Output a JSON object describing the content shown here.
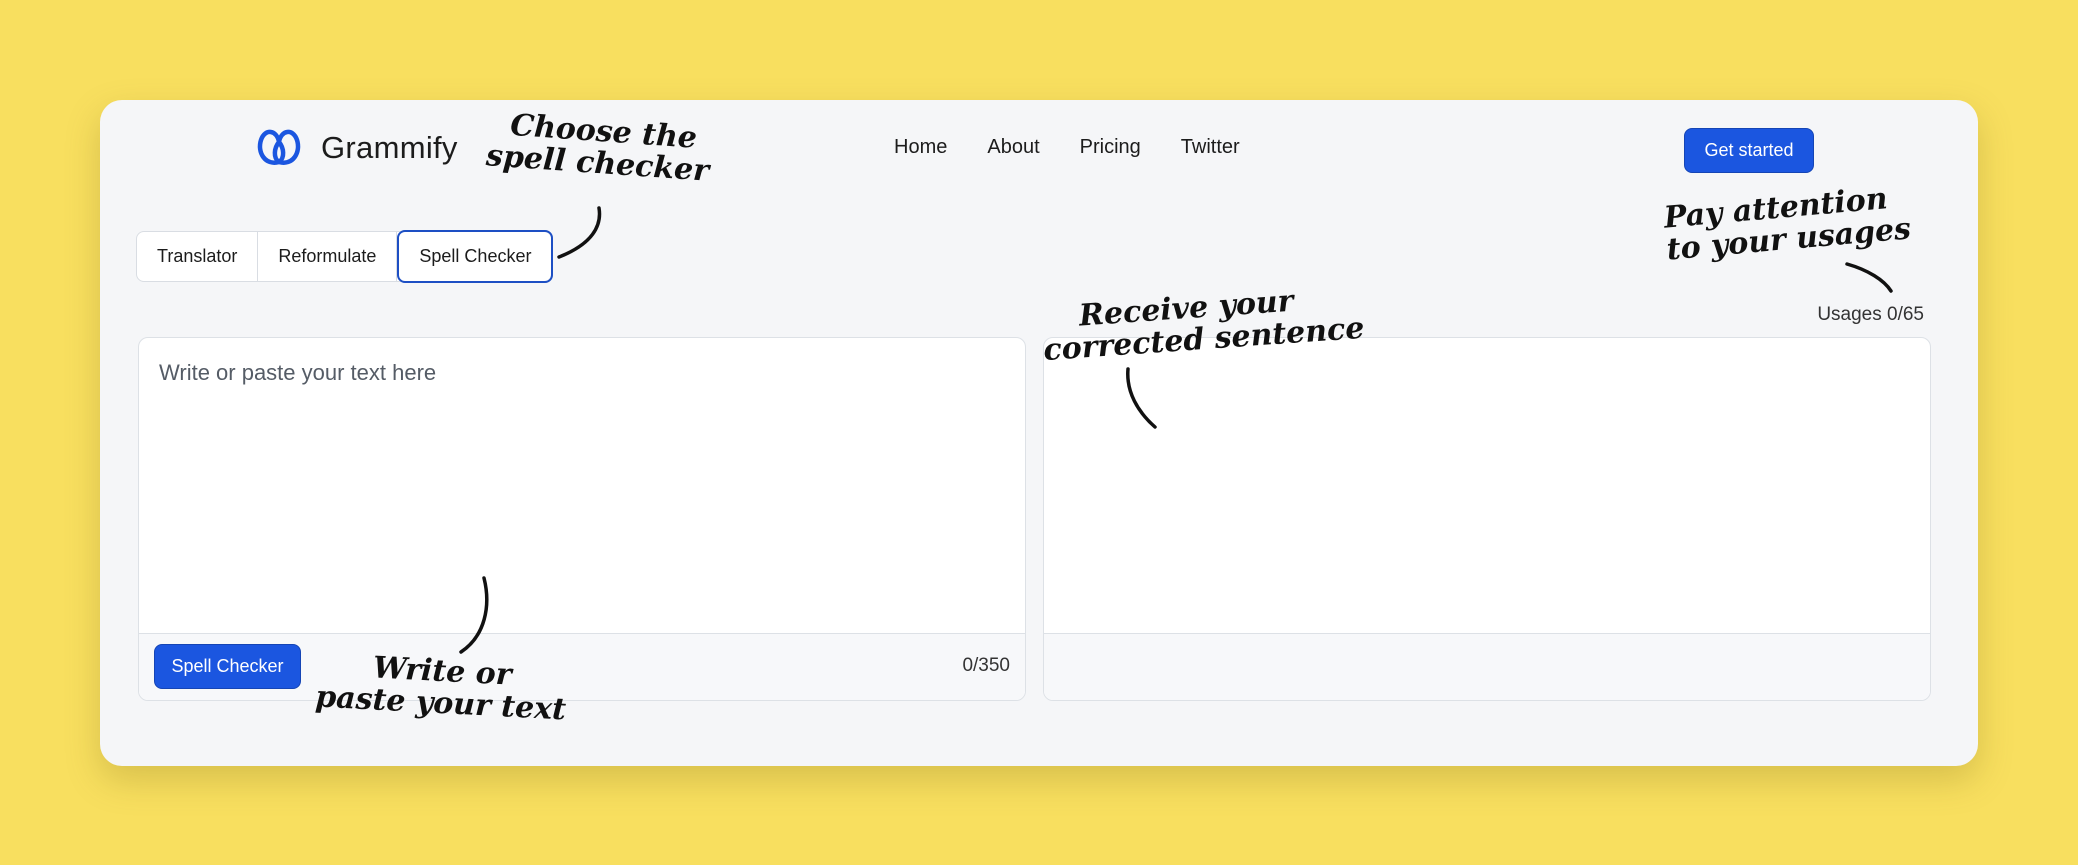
{
  "brand": {
    "name": "Grammify",
    "icon": "double-loop-logo-icon",
    "accent_color": "#1b56e0"
  },
  "nav": {
    "items": [
      "Home",
      "About",
      "Pricing",
      "Twitter"
    ],
    "cta_label": "Get started"
  },
  "tabs": {
    "items": [
      "Translator",
      "Reformulate",
      "Spell Checker"
    ],
    "active": "Spell Checker"
  },
  "usages": {
    "label": "Usages 0/65"
  },
  "input_panel": {
    "placeholder": "Write or paste your text here",
    "value": "",
    "button_label": "Spell Checker",
    "char_count": "0/350"
  },
  "output_panel": {
    "value": ""
  },
  "annotations": {
    "choose": [
      "Choose the",
      "spell checker"
    ],
    "usages": [
      "Pay attention",
      "to your usages"
    ],
    "receive": [
      "Receive your",
      "corrected sentence"
    ],
    "write": [
      "Write or",
      "paste your text"
    ]
  },
  "colors": {
    "background": "#f8df5f",
    "card": "#f5f6f8",
    "primary_button": "#1b56e0",
    "active_tab_border": "#1d4fc4"
  }
}
